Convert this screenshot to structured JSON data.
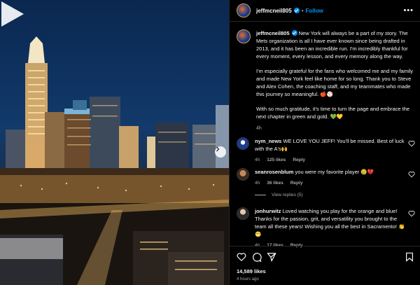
{
  "post": {
    "username": "jeffmcneil805",
    "follow_label": "Follow",
    "more_label": "•••",
    "caption": {
      "p1": "New York will always be a part of my story. The Mets organization is all I have ever known since being drafted in 2013, and it has been an incredible run. I'm incredibly thankful for every moment, every lesson, and every memory along the way.",
      "p2": "I'm especially grateful for the fans who welcomed me and my family and made New York feel like home for so long. Thank you to Steve and Alex Cohen, the coaching staff, and my teammates who made this journey so meaningful. 🍎⚾",
      "p3": "With so much gratitude, it's time to turn the page and embrace the next chapter in green and gold. 💚💛",
      "time": "4h"
    },
    "comments": [
      {
        "username": "nym_news",
        "text": "WE LOVE YOU JEFF! You'll be missed. Best of luck with the A's🙌",
        "time": "4h",
        "likes": "125 likes",
        "reply": "Reply"
      },
      {
        "username": "seanrosenblum",
        "text": "you were my favorite player 😢💔",
        "time": "4h",
        "likes": "36 likes",
        "reply": "Reply"
      },
      {
        "username": "jonhurwitz",
        "text": "Loved watching you play for the orange and blue! Thanks for the passion, grit, and versatility you brought to the team all these years! Wishing you all the best in Sacramento! 👏😁",
        "time": "4h",
        "likes": "17 likes",
        "reply": "Reply"
      }
    ],
    "view_replies": "View replies (5)",
    "like_count": "14,589 likes",
    "posted_ago": "4 hours ago"
  },
  "colors": {
    "accent": "#0095f6",
    "muted": "#a8a8a8",
    "divider": "#262626",
    "background": "#000000"
  },
  "icons": {
    "verified": "verified-badge-icon",
    "like": "heart-icon",
    "comment": "comment-icon",
    "share": "share-icon",
    "save": "bookmark-icon",
    "play": "play-icon",
    "next": "chevron-right-icon"
  }
}
